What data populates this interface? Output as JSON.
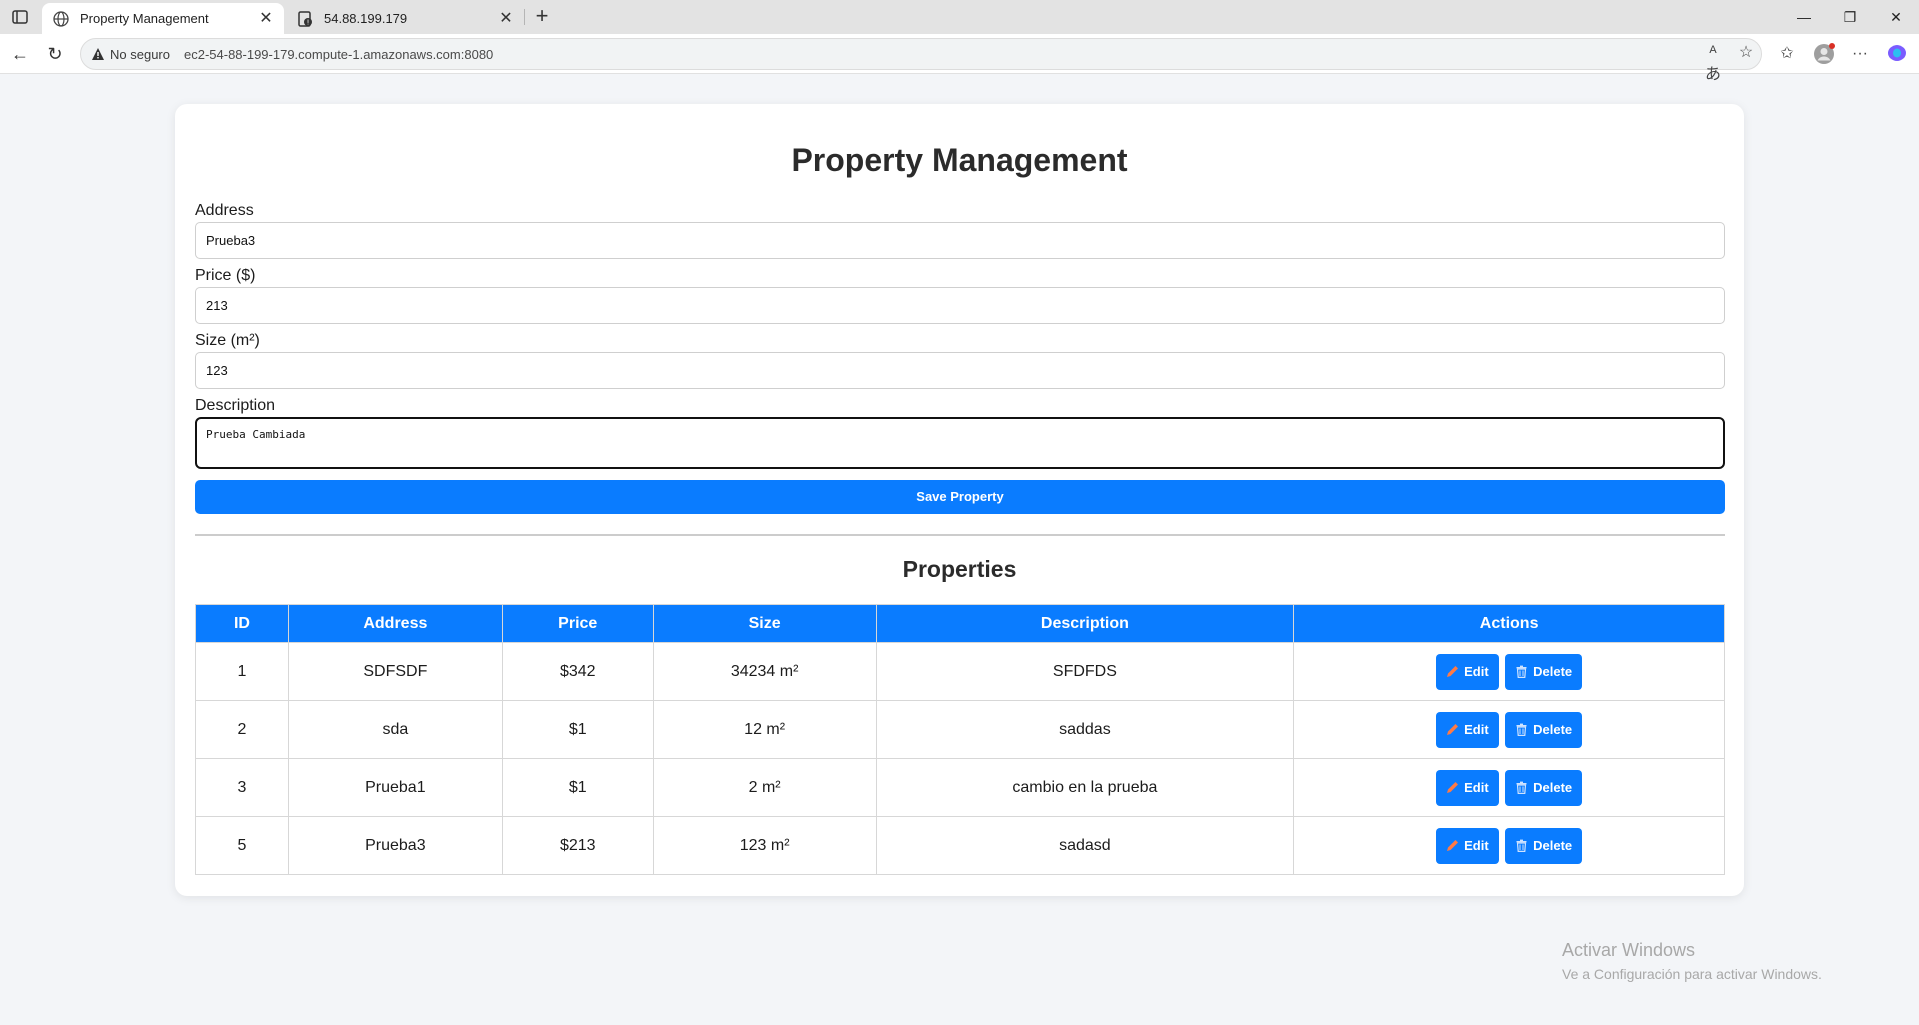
{
  "browser": {
    "tabs": [
      {
        "title": "Property Management",
        "active": true,
        "icon": "globe-icon"
      },
      {
        "title": "54.88.199.179",
        "active": false,
        "icon": "insecure-page-icon"
      }
    ],
    "address_bar": {
      "security_text": "No seguro",
      "url": "ec2-54-88-199-179.compute-1.amazonaws.com:8080"
    }
  },
  "page": {
    "title": "Property Management",
    "form": {
      "address_label": "Address",
      "address_value": "Prueba3",
      "price_label": "Price ($)",
      "price_value": "213",
      "size_label": "Size (m²)",
      "size_value": "123",
      "description_label": "Description",
      "description_value": "Prueba Cambiada",
      "save_label": "Save Property"
    },
    "properties_title": "Properties",
    "table": {
      "headers": [
        "ID",
        "Address",
        "Price",
        "Size",
        "Description",
        "Actions"
      ],
      "edit_label": "Edit",
      "delete_label": "Delete",
      "rows": [
        {
          "id": "1",
          "address": "SDFSDF",
          "price": "$342",
          "size": "34234 m²",
          "description": "SFDFDS"
        },
        {
          "id": "2",
          "address": "sda",
          "price": "$1",
          "size": "12 m²",
          "description": "saddas"
        },
        {
          "id": "3",
          "address": "Prueba1",
          "price": "$1",
          "size": "2 m²",
          "description": "cambio en la prueba"
        },
        {
          "id": "5",
          "address": "Prueba3",
          "price": "$213",
          "size": "123 m²",
          "description": "sadasd"
        }
      ]
    }
  },
  "watermark": {
    "line1": "Activar Windows",
    "line2": "Ve a Configuración para activar Windows."
  },
  "colors": {
    "primary": "#0a7cff",
    "edit_icon": "#ff7a45",
    "page_bg": "#f3f5f8"
  }
}
